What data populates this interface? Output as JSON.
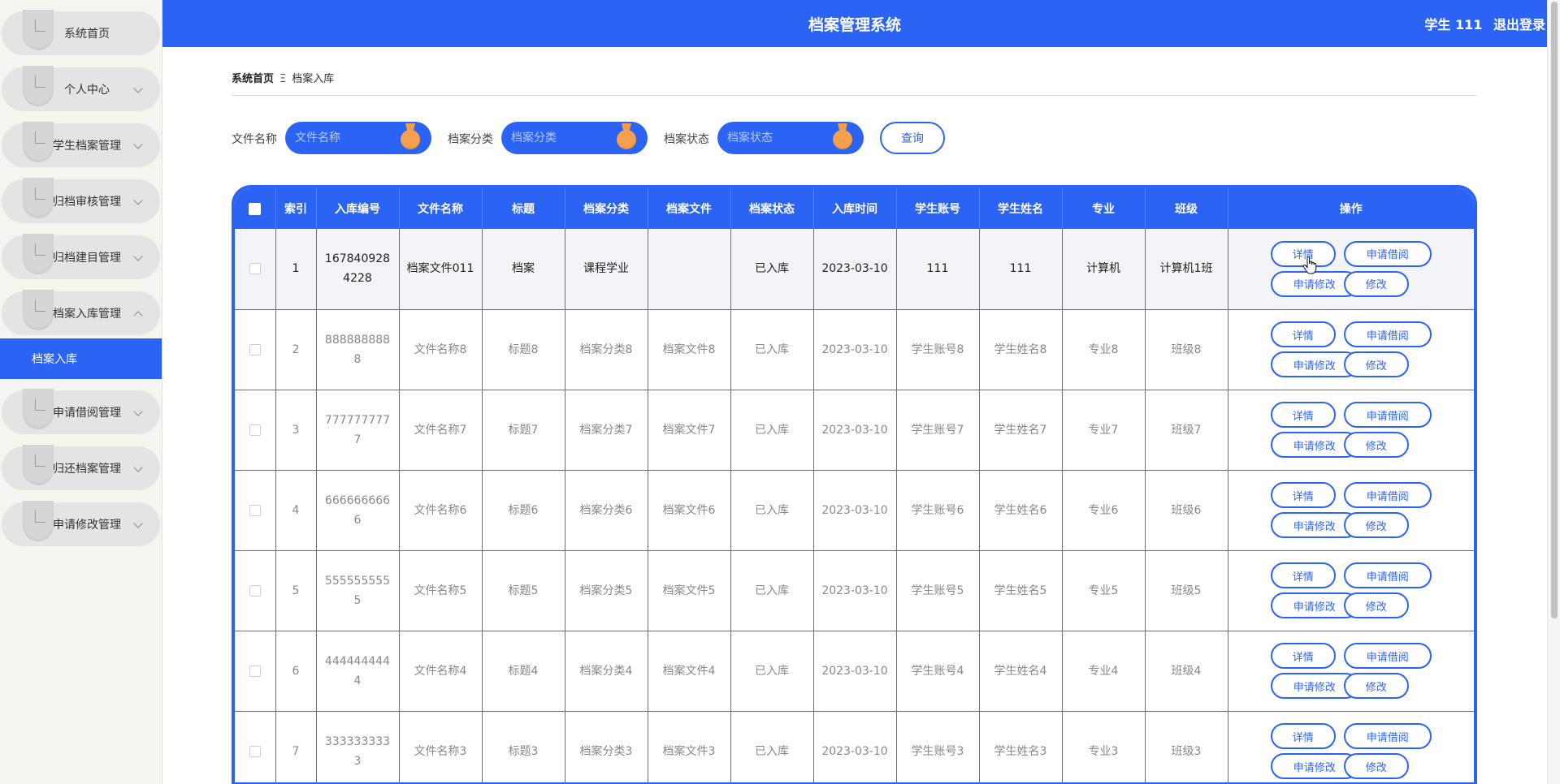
{
  "app_title": "档案管理系统",
  "header": {
    "user_label": "学生 111",
    "logout_label": "退出登录"
  },
  "sidebar": {
    "items": [
      {
        "label": "系统首页",
        "has_chevron": false
      },
      {
        "label": "个人中心",
        "has_chevron": true
      },
      {
        "label": "学生档案管理",
        "has_chevron": true
      },
      {
        "label": "归档审核管理",
        "has_chevron": true
      },
      {
        "label": "归档建目管理",
        "has_chevron": true
      },
      {
        "label": "档案入库管理",
        "has_chevron": true,
        "expanded": true
      },
      {
        "label": "申请借阅管理",
        "has_chevron": true
      },
      {
        "label": "归还档案管理",
        "has_chevron": true
      },
      {
        "label": "申请修改管理",
        "has_chevron": true
      }
    ],
    "active_sub": "档案入库"
  },
  "breadcrumb": {
    "home": "系统首页",
    "separator": "Ξ",
    "current": "档案入库"
  },
  "search": {
    "file_name_label": "文件名称",
    "file_name_placeholder": "文件名称",
    "category_label": "档案分类",
    "category_placeholder": "档案分类",
    "status_label": "档案状态",
    "status_placeholder": "档案状态",
    "query_label": "查询"
  },
  "table": {
    "headers": [
      "",
      "索引",
      "入库编号",
      "文件名称",
      "标题",
      "档案分类",
      "档案文件",
      "档案状态",
      "入库时间",
      "学生账号",
      "学生姓名",
      "专业",
      "班级",
      "操作"
    ],
    "actions": {
      "detail": "详情",
      "borrow": "申请借阅",
      "apply_edit": "申请修改",
      "edit": "修改"
    },
    "rows": [
      [
        "1",
        "1678409284228",
        "档案文件011",
        "档案",
        "课程学业",
        "",
        "已入库",
        "2023-03-10",
        "111",
        "111",
        "计算机",
        "计算机1班"
      ],
      [
        "2",
        "8888888888",
        "文件名称8",
        "标题8",
        "档案分类8",
        "档案文件8",
        "已入库",
        "2023-03-10",
        "学生账号8",
        "学生姓名8",
        "专业8",
        "班级8"
      ],
      [
        "3",
        "7777777777",
        "文件名称7",
        "标题7",
        "档案分类7",
        "档案文件7",
        "已入库",
        "2023-03-10",
        "学生账号7",
        "学生姓名7",
        "专业7",
        "班级7"
      ],
      [
        "4",
        "6666666666",
        "文件名称6",
        "标题6",
        "档案分类6",
        "档案文件6",
        "已入库",
        "2023-03-10",
        "学生账号6",
        "学生姓名6",
        "专业6",
        "班级6"
      ],
      [
        "5",
        "5555555555",
        "文件名称5",
        "标题5",
        "档案分类5",
        "档案文件5",
        "已入库",
        "2023-03-10",
        "学生账号5",
        "学生姓名5",
        "专业5",
        "班级5"
      ],
      [
        "6",
        "4444444444",
        "文件名称4",
        "标题4",
        "档案分类4",
        "档案文件4",
        "已入库",
        "2023-03-10",
        "学生账号4",
        "学生姓名4",
        "专业4",
        "班级4"
      ],
      [
        "7",
        "3333333333",
        "文件名称3",
        "标题3",
        "档案分类3",
        "档案文件3",
        "已入库",
        "2023-03-10",
        "学生账号3",
        "学生姓名3",
        "专业3",
        "班级3"
      ]
    ]
  },
  "colors": {
    "primary": "#2b63f5",
    "accent_orange": "#f5a04c",
    "sidebar_bg": "#f4f4f0"
  }
}
